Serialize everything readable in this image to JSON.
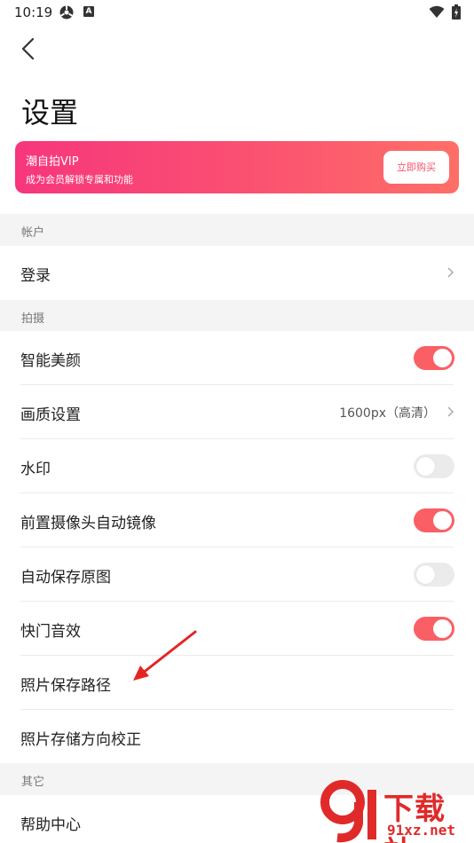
{
  "status_bar": {
    "time": "10:19",
    "a_badge": "A"
  },
  "header": {
    "title": "设置"
  },
  "vip": {
    "title": "潮自拍VIP",
    "subtitle": "成为会员解锁专属和功能",
    "buy_label": "立即购买"
  },
  "sections": {
    "account": {
      "title": "帐户"
    },
    "shooting": {
      "title": "拍摄"
    },
    "other": {
      "title": "其它"
    }
  },
  "rows": {
    "login": {
      "label": "登录"
    },
    "beauty": {
      "label": "智能美颜",
      "enabled": true
    },
    "quality": {
      "label": "画质设置",
      "value": "1600px（高清）"
    },
    "watermark": {
      "label": "水印",
      "enabled": false
    },
    "mirror": {
      "label": "前置摄像头自动镜像",
      "enabled": true
    },
    "save_original": {
      "label": "自动保存原图",
      "enabled": false
    },
    "shutter_sound": {
      "label": "快门音效",
      "enabled": true
    },
    "save_path": {
      "label": "照片保存路径"
    },
    "orientation": {
      "label": "照片存储方向校正"
    },
    "help": {
      "label": "帮助中心"
    }
  },
  "watermark_logo": {
    "title": "下载站",
    "sub": "91xz.net"
  },
  "colors": {
    "accent": "#fa5f66",
    "vip_start": "#f7367c",
    "vip_end": "#fe6f67",
    "section_bg": "#f4f4f4"
  }
}
